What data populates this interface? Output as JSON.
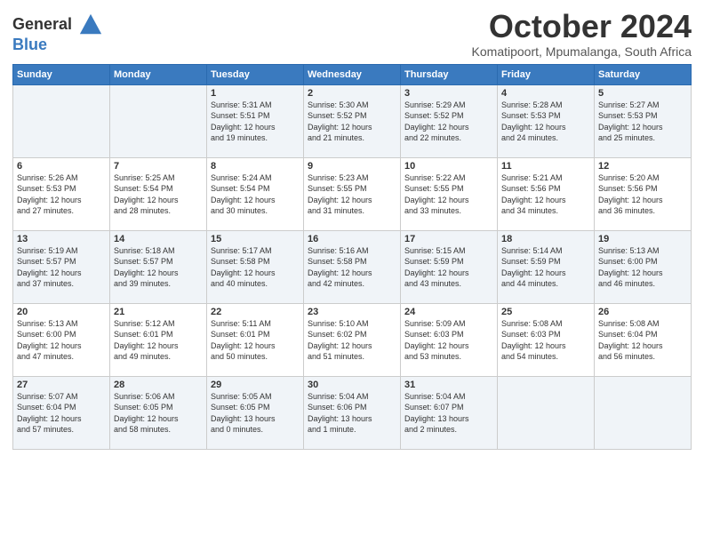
{
  "header": {
    "logo_line1": "General",
    "logo_line2": "Blue",
    "month": "October 2024",
    "location": "Komatipoort, Mpumalanga, South Africa"
  },
  "days_of_week": [
    "Sunday",
    "Monday",
    "Tuesday",
    "Wednesday",
    "Thursday",
    "Friday",
    "Saturday"
  ],
  "weeks": [
    [
      {
        "day": "",
        "info": ""
      },
      {
        "day": "",
        "info": ""
      },
      {
        "day": "1",
        "info": "Sunrise: 5:31 AM\nSunset: 5:51 PM\nDaylight: 12 hours\nand 19 minutes."
      },
      {
        "day": "2",
        "info": "Sunrise: 5:30 AM\nSunset: 5:52 PM\nDaylight: 12 hours\nand 21 minutes."
      },
      {
        "day": "3",
        "info": "Sunrise: 5:29 AM\nSunset: 5:52 PM\nDaylight: 12 hours\nand 22 minutes."
      },
      {
        "day": "4",
        "info": "Sunrise: 5:28 AM\nSunset: 5:53 PM\nDaylight: 12 hours\nand 24 minutes."
      },
      {
        "day": "5",
        "info": "Sunrise: 5:27 AM\nSunset: 5:53 PM\nDaylight: 12 hours\nand 25 minutes."
      }
    ],
    [
      {
        "day": "6",
        "info": "Sunrise: 5:26 AM\nSunset: 5:53 PM\nDaylight: 12 hours\nand 27 minutes."
      },
      {
        "day": "7",
        "info": "Sunrise: 5:25 AM\nSunset: 5:54 PM\nDaylight: 12 hours\nand 28 minutes."
      },
      {
        "day": "8",
        "info": "Sunrise: 5:24 AM\nSunset: 5:54 PM\nDaylight: 12 hours\nand 30 minutes."
      },
      {
        "day": "9",
        "info": "Sunrise: 5:23 AM\nSunset: 5:55 PM\nDaylight: 12 hours\nand 31 minutes."
      },
      {
        "day": "10",
        "info": "Sunrise: 5:22 AM\nSunset: 5:55 PM\nDaylight: 12 hours\nand 33 minutes."
      },
      {
        "day": "11",
        "info": "Sunrise: 5:21 AM\nSunset: 5:56 PM\nDaylight: 12 hours\nand 34 minutes."
      },
      {
        "day": "12",
        "info": "Sunrise: 5:20 AM\nSunset: 5:56 PM\nDaylight: 12 hours\nand 36 minutes."
      }
    ],
    [
      {
        "day": "13",
        "info": "Sunrise: 5:19 AM\nSunset: 5:57 PM\nDaylight: 12 hours\nand 37 minutes."
      },
      {
        "day": "14",
        "info": "Sunrise: 5:18 AM\nSunset: 5:57 PM\nDaylight: 12 hours\nand 39 minutes."
      },
      {
        "day": "15",
        "info": "Sunrise: 5:17 AM\nSunset: 5:58 PM\nDaylight: 12 hours\nand 40 minutes."
      },
      {
        "day": "16",
        "info": "Sunrise: 5:16 AM\nSunset: 5:58 PM\nDaylight: 12 hours\nand 42 minutes."
      },
      {
        "day": "17",
        "info": "Sunrise: 5:15 AM\nSunset: 5:59 PM\nDaylight: 12 hours\nand 43 minutes."
      },
      {
        "day": "18",
        "info": "Sunrise: 5:14 AM\nSunset: 5:59 PM\nDaylight: 12 hours\nand 44 minutes."
      },
      {
        "day": "19",
        "info": "Sunrise: 5:13 AM\nSunset: 6:00 PM\nDaylight: 12 hours\nand 46 minutes."
      }
    ],
    [
      {
        "day": "20",
        "info": "Sunrise: 5:13 AM\nSunset: 6:00 PM\nDaylight: 12 hours\nand 47 minutes."
      },
      {
        "day": "21",
        "info": "Sunrise: 5:12 AM\nSunset: 6:01 PM\nDaylight: 12 hours\nand 49 minutes."
      },
      {
        "day": "22",
        "info": "Sunrise: 5:11 AM\nSunset: 6:01 PM\nDaylight: 12 hours\nand 50 minutes."
      },
      {
        "day": "23",
        "info": "Sunrise: 5:10 AM\nSunset: 6:02 PM\nDaylight: 12 hours\nand 51 minutes."
      },
      {
        "day": "24",
        "info": "Sunrise: 5:09 AM\nSunset: 6:03 PM\nDaylight: 12 hours\nand 53 minutes."
      },
      {
        "day": "25",
        "info": "Sunrise: 5:08 AM\nSunset: 6:03 PM\nDaylight: 12 hours\nand 54 minutes."
      },
      {
        "day": "26",
        "info": "Sunrise: 5:08 AM\nSunset: 6:04 PM\nDaylight: 12 hours\nand 56 minutes."
      }
    ],
    [
      {
        "day": "27",
        "info": "Sunrise: 5:07 AM\nSunset: 6:04 PM\nDaylight: 12 hours\nand 57 minutes."
      },
      {
        "day": "28",
        "info": "Sunrise: 5:06 AM\nSunset: 6:05 PM\nDaylight: 12 hours\nand 58 minutes."
      },
      {
        "day": "29",
        "info": "Sunrise: 5:05 AM\nSunset: 6:05 PM\nDaylight: 13 hours\nand 0 minutes."
      },
      {
        "day": "30",
        "info": "Sunrise: 5:04 AM\nSunset: 6:06 PM\nDaylight: 13 hours\nand 1 minute."
      },
      {
        "day": "31",
        "info": "Sunrise: 5:04 AM\nSunset: 6:07 PM\nDaylight: 13 hours\nand 2 minutes."
      },
      {
        "day": "",
        "info": ""
      },
      {
        "day": "",
        "info": ""
      }
    ]
  ]
}
